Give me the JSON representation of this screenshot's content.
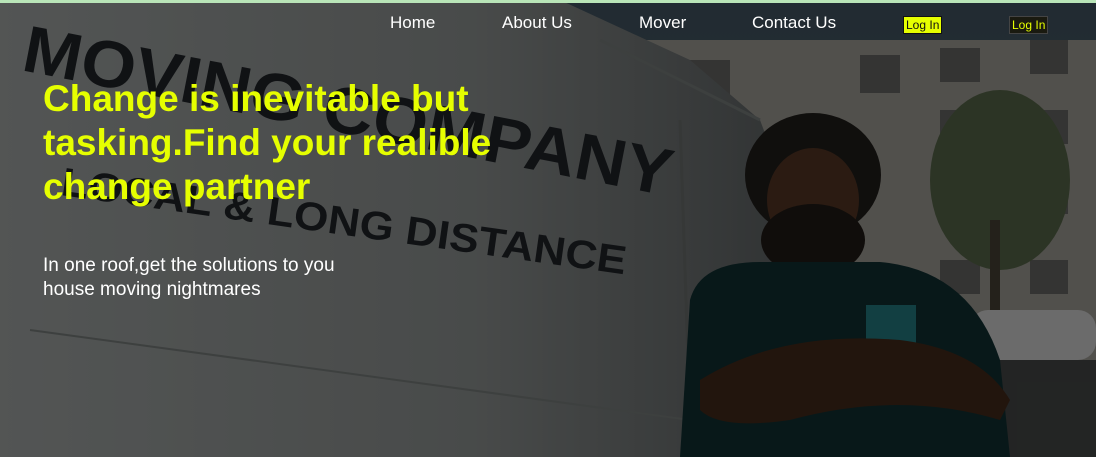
{
  "nav": {
    "links": [
      {
        "label": "Home"
      },
      {
        "label": "About Us"
      },
      {
        "label": "Mover"
      },
      {
        "label": "Contact Us"
      }
    ],
    "login_primary": "Log In",
    "login_secondary": "Log In"
  },
  "hero": {
    "title": "Change is inevitable but tasking.Find your realible change partner",
    "subtitle": "In one roof,get the solutions to you house moving nightmares",
    "van_text_line1": "MOVING COMPANY",
    "van_text_line2": "LOCAL & LONG DISTANCE"
  },
  "colors": {
    "accent": "#e6ff00",
    "text_light": "#ffffff",
    "top_line": "#b9e5b8",
    "overlay": "rgba(0,0,0,0.42)"
  }
}
